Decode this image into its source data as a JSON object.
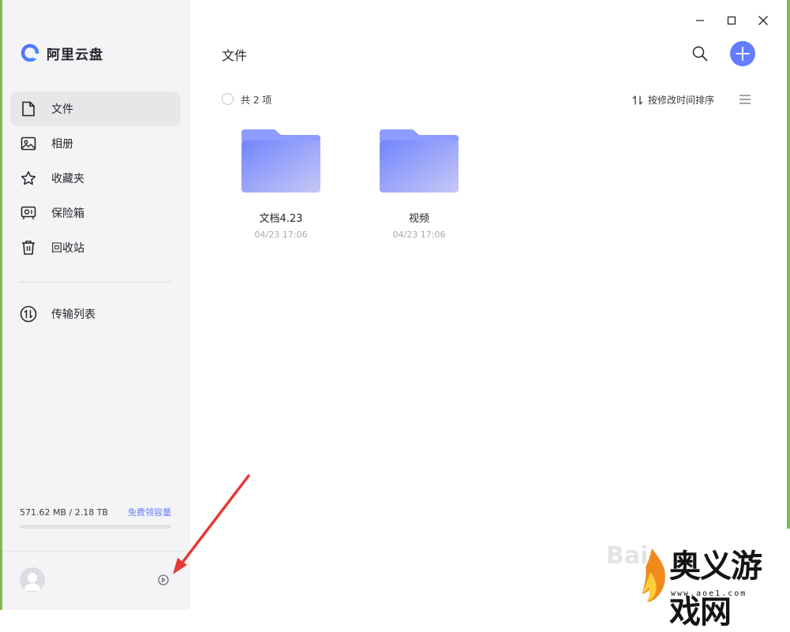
{
  "app": {
    "name": "阿里云盘",
    "accent": "#637dff"
  },
  "sidebar": {
    "items": [
      {
        "label": "文件",
        "icon": "file-icon",
        "active": true
      },
      {
        "label": "相册",
        "icon": "photo-icon",
        "active": false
      },
      {
        "label": "收藏夹",
        "icon": "star-icon",
        "active": false
      },
      {
        "label": "保险箱",
        "icon": "safe-icon",
        "active": false
      },
      {
        "label": "回收站",
        "icon": "trash-icon",
        "active": false
      }
    ],
    "transfer_label": "传输列表",
    "storage": {
      "used_text": "571.62 MB / 2.18 TB",
      "link": "免费领容量",
      "fraction_used": 0.0003
    }
  },
  "main": {
    "title": "文件",
    "count_text": "共 2 项",
    "sort_label": "按修改时间排序",
    "files": [
      {
        "name": "文档4.23",
        "date": "04/23 17:06"
      },
      {
        "name": "视频",
        "date": "04/23 17:06"
      }
    ]
  },
  "watermark": {
    "baidu": "Bai",
    "site_name": "奥义游戏网",
    "url": "www.aoe1.com"
  }
}
